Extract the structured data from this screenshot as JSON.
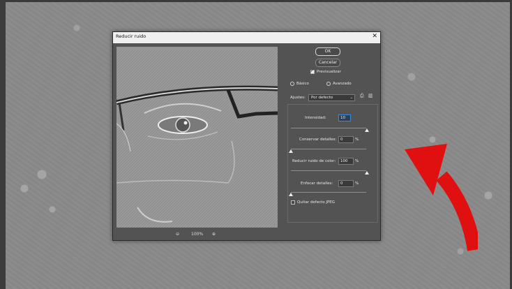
{
  "dialog": {
    "title": "Reducir ruido",
    "close_glyph": "✕"
  },
  "buttons": {
    "ok": "OK",
    "cancel": "Cancelar"
  },
  "preview_option": {
    "label": "Previsualizar",
    "checked": true
  },
  "mode": {
    "basic": {
      "label": "Básico",
      "selected": true
    },
    "advanced": {
      "label": "Avanzado",
      "selected": false
    }
  },
  "settings": {
    "label": "Ajustes:",
    "value": "Por defecto",
    "save_icon": "save-settings-icon",
    "delete_icon": "trash-icon"
  },
  "sliders": [
    {
      "label": "Intensidad:",
      "value": "10",
      "unit": "",
      "level": 1.0
    },
    {
      "label": "Conservar detalles:",
      "value": "0",
      "unit": "%",
      "level": 0.0
    },
    {
      "label": "Reducir ruido de color:",
      "value": "100",
      "unit": "%",
      "level": 1.0
    },
    {
      "label": "Enfocar detalles:",
      "value": "0",
      "unit": "%",
      "level": 0.0
    }
  ],
  "jpeg_option": {
    "label": "Quitar defecto JPEG",
    "checked": false
  },
  "zoom": {
    "zoom_out_icon": "zoom-out-icon",
    "level": "100%",
    "zoom_in_icon": "zoom-in-icon"
  },
  "colors": {
    "dialog_bg": "#535353",
    "annotation_arrow": "#e01010"
  }
}
